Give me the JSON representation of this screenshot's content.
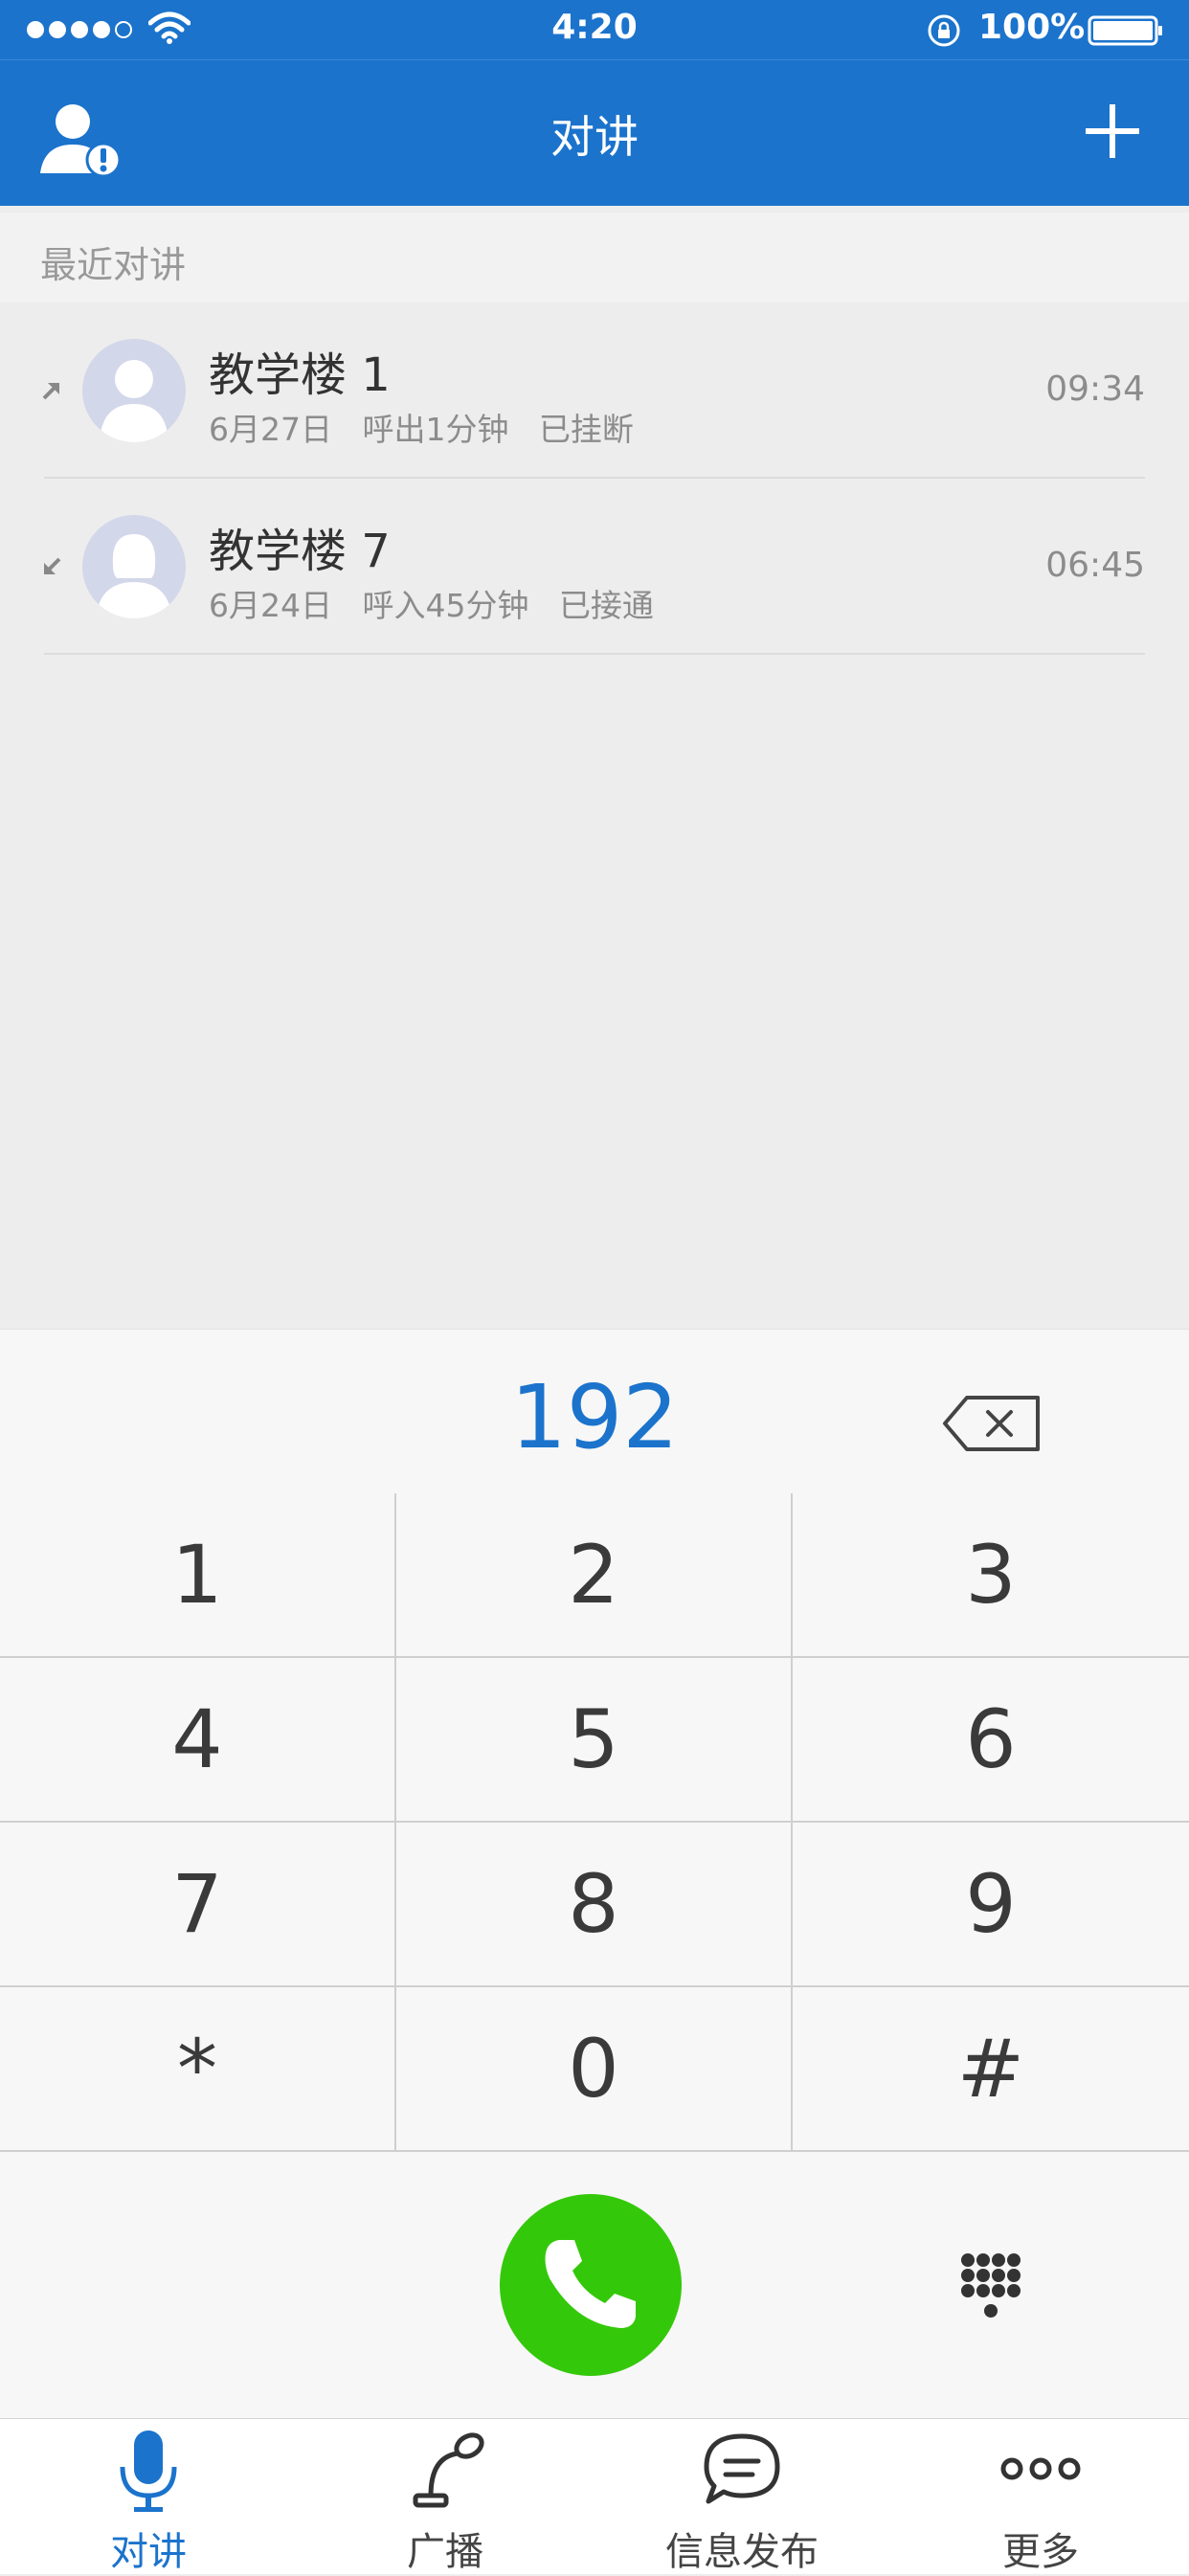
{
  "status_bar": {
    "time": "4:20",
    "battery_percent": "100%",
    "signal_bars": 4,
    "signal_bars_max": 5
  },
  "header": {
    "title": "对讲",
    "left_icon": "contact-alert-icon",
    "right_icon": "plus-icon"
  },
  "recent": {
    "section_title": "最近对讲",
    "calls": [
      {
        "name": "教学楼 1",
        "detail": "6月27日   呼出1分钟   已挂断",
        "time": "09:34",
        "direction": "outgoing",
        "avatar": "male"
      },
      {
        "name": "教学楼 7",
        "detail": "6月24日   呼入45分钟   已接通",
        "time": "06:45",
        "direction": "incoming",
        "avatar": "female"
      }
    ]
  },
  "dialer": {
    "number": "192",
    "keys": [
      "1",
      "2",
      "3",
      "4",
      "5",
      "6",
      "7",
      "8",
      "9",
      "*",
      "0",
      "#"
    ]
  },
  "tabs": [
    {
      "label": "对讲",
      "icon": "microphone-icon",
      "active": true
    },
    {
      "label": "广播",
      "icon": "broadcast-mic-icon",
      "active": false
    },
    {
      "label": "信息发布",
      "icon": "chat-bubble-icon",
      "active": false
    },
    {
      "label": "更多",
      "icon": "more-dots-icon",
      "active": false
    }
  ],
  "colors": {
    "brand_blue": "#1b73cc",
    "call_green": "#34c80a"
  }
}
